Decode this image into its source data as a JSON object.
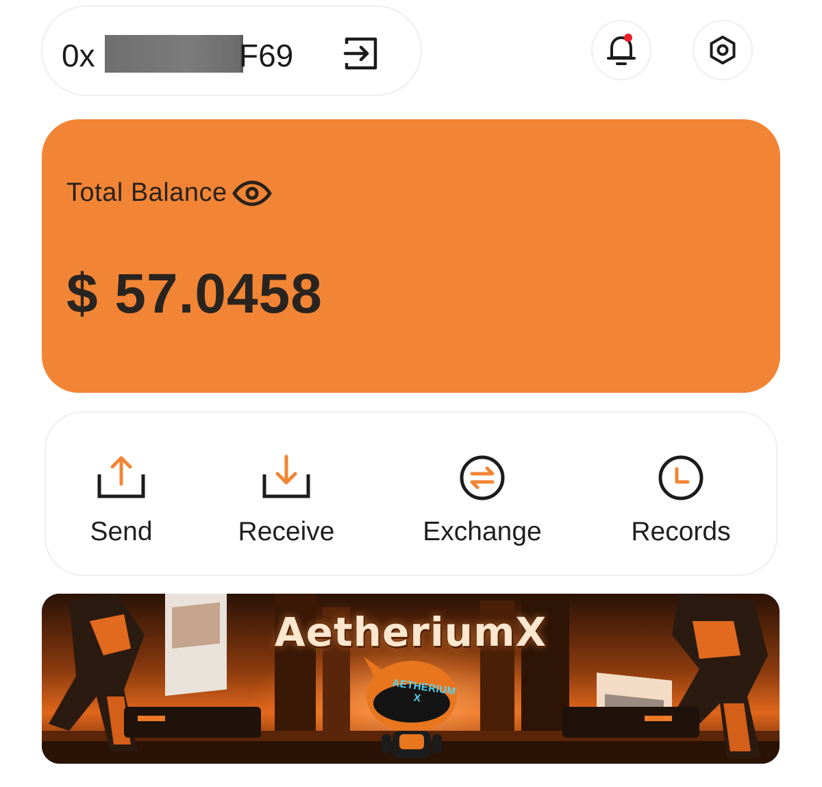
{
  "header": {
    "address_prefix": "0x",
    "address_suffix": "F69",
    "logout_icon": "logout-icon",
    "notification_icon": "bell-icon",
    "notification_dot_color": "#e8202a",
    "settings_icon": "settings-icon"
  },
  "balance": {
    "label": "Total Balance",
    "value": "$ 57.0458",
    "visibility_icon": "eye-icon",
    "card_color": "#f28535"
  },
  "actions": [
    {
      "label": "Send",
      "icon": "send-icon"
    },
    {
      "label": "Receive",
      "icon": "receive-icon"
    },
    {
      "label": "Exchange",
      "icon": "exchange-icon"
    },
    {
      "label": "Records",
      "icon": "records-icon"
    }
  ],
  "banner": {
    "title": "AetheriumX",
    "mascot_text": "AETHERIUM",
    "mascot_subtext": "X"
  },
  "colors": {
    "accent": "#f28535",
    "icon_dark": "#1c1c1c"
  }
}
